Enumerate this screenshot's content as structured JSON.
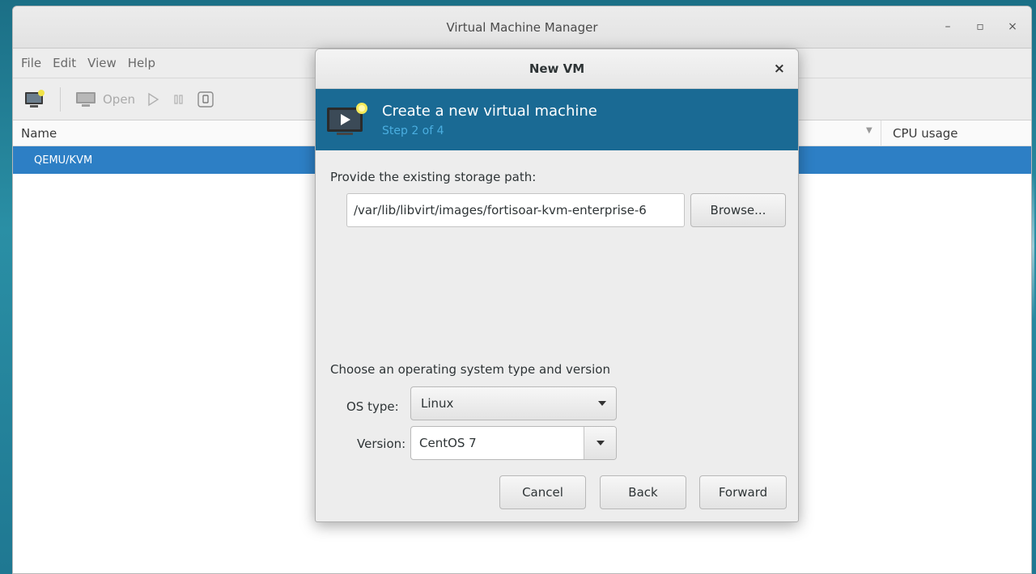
{
  "main_window": {
    "title": "Virtual Machine Manager",
    "controls": {
      "minimize": "–",
      "maximize": "▫",
      "close": "×"
    },
    "menu": [
      "File",
      "Edit",
      "View",
      "Help"
    ],
    "toolbar": {
      "open_label": "Open"
    },
    "columns": {
      "name": "Name",
      "cpu_usage": "CPU usage"
    },
    "rows": [
      "QEMU/KVM"
    ]
  },
  "dialog": {
    "title": "New VM",
    "close": "×",
    "banner": {
      "title": "Create a new virtual machine",
      "step": "Step 2 of 4"
    },
    "storage_label": "Provide the existing storage path:",
    "storage_path": "/var/lib/libvirt/images/fortisoar-kvm-enterprise-6",
    "browse_label": "Browse...",
    "os_section_label": "Choose an operating system type and version",
    "os_type_label": "OS type:",
    "os_type_value": "Linux",
    "version_label": "Version:",
    "version_value": "CentOS 7",
    "buttons": {
      "cancel": "Cancel",
      "back": "Back",
      "forward": "Forward"
    }
  },
  "colors": {
    "banner_bg": "#1a6a94",
    "banner_step": "#4aaee0",
    "selection": "#2d7fc5"
  }
}
